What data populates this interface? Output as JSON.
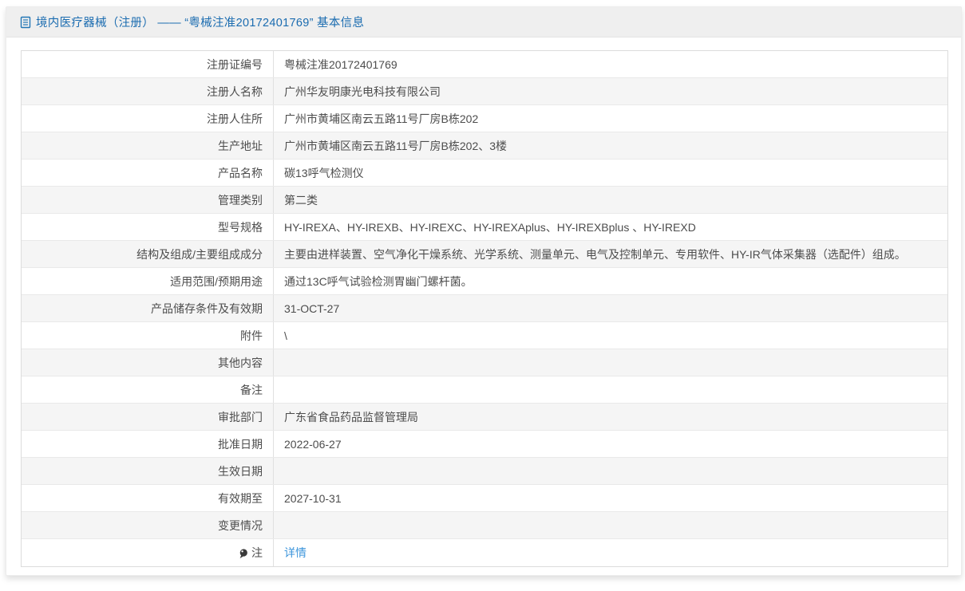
{
  "header": {
    "icon": "document-icon",
    "title": "境内医疗器械（注册） —— “粤械注准20172401769” 基本信息"
  },
  "colors": {
    "title_blue": "#1b6cb0",
    "link_blue": "#3c95db",
    "title_bar_bg": "#efefef",
    "row_alt_bg": "#f5f5f5",
    "table_border": "#dcdcdc",
    "text": "#4d4d4d"
  },
  "table": {
    "rows": [
      {
        "label": "注册证编号",
        "value": "粤械注准20172401769"
      },
      {
        "label": "注册人名称",
        "value": "广州华友明康光电科技有限公司"
      },
      {
        "label": "注册人住所",
        "value": "广州市黄埔区南云五路11号厂房B栋202"
      },
      {
        "label": "生产地址",
        "value": "广州市黄埔区南云五路11号厂房B栋202、3楼"
      },
      {
        "label": "产品名称",
        "value": "碳13呼气检测仪"
      },
      {
        "label": "管理类别",
        "value": "第二类"
      },
      {
        "label": "型号规格",
        "value": "HY-IREXA、HY-IREXB、HY-IREXC、HY-IREXAplus、HY-IREXBplus 、HY-IREXD"
      },
      {
        "label": "结构及组成/主要组成成分",
        "value": "主要由进样装置、空气净化干燥系统、光学系统、测量单元、电气及控制单元、专用软件、HY-IR气体采集器（选配件）组成。"
      },
      {
        "label": "适用范围/预期用途",
        "value": "通过13C呼气试验检测胃幽门螺杆菌。"
      },
      {
        "label": "产品储存条件及有效期",
        "value": "31-OCT-27"
      },
      {
        "label": "附件",
        "value": "\\"
      },
      {
        "label": "其他内容",
        "value": ""
      },
      {
        "label": "备注",
        "value": ""
      },
      {
        "label": "审批部门",
        "value": "广东省食品药品监督管理局"
      },
      {
        "label": "批准日期",
        "value": "2022-06-27"
      },
      {
        "label": "生效日期",
        "value": ""
      },
      {
        "label": "有效期至",
        "value": "2027-10-31"
      },
      {
        "label": "变更情况",
        "value": ""
      },
      {
        "label": "注",
        "value": "详情",
        "link": true,
        "label_icon": "note-balloon-icon"
      }
    ]
  }
}
